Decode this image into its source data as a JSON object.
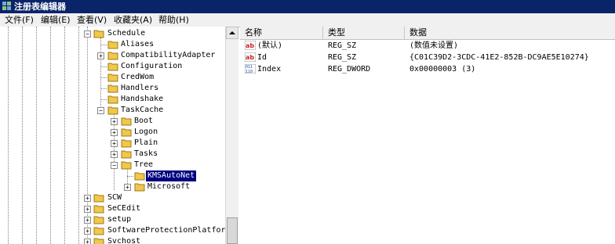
{
  "window": {
    "title": "注册表编辑器",
    "app_icon": "registry-editor-icon"
  },
  "menu": [
    {
      "label": "文件(F)"
    },
    {
      "label": "编辑(E)"
    },
    {
      "label": "查看(V)"
    },
    {
      "label": "收藏夹(A)"
    },
    {
      "label": "帮助(H)"
    }
  ],
  "tree": {
    "nodes": [
      {
        "label": "Schedule",
        "expander": "−"
      },
      {
        "label": "Aliases",
        "expander": ""
      },
      {
        "label": "CompatibilityAdapter",
        "expander": "+"
      },
      {
        "label": "Configuration",
        "expander": ""
      },
      {
        "label": "CredWom",
        "expander": ""
      },
      {
        "label": "Handlers",
        "expander": ""
      },
      {
        "label": "Handshake",
        "expander": ""
      },
      {
        "label": "TaskCache",
        "expander": "−"
      },
      {
        "label": "Boot",
        "expander": "+"
      },
      {
        "label": "Logon",
        "expander": "+"
      },
      {
        "label": "Plain",
        "expander": "+"
      },
      {
        "label": "Tasks",
        "expander": "+"
      },
      {
        "label": "Tree",
        "expander": "−"
      },
      {
        "label": "KMSAutoNet",
        "expander": "",
        "selected": true
      },
      {
        "label": "Microsoft",
        "expander": "+"
      },
      {
        "label": "SCW",
        "expander": "+"
      },
      {
        "label": "SeCEdit",
        "expander": "+"
      },
      {
        "label": "setup",
        "expander": "+"
      },
      {
        "label": "SoftwareProtectionPlatform",
        "expander": "+"
      },
      {
        "label": "Svchost",
        "expander": "+"
      }
    ]
  },
  "list": {
    "columns": [
      "名称",
      "类型",
      "数据"
    ],
    "rows": [
      {
        "name": "(默认)",
        "type": "REG_SZ",
        "data": "(数值未设置)",
        "icon": "string-value-icon"
      },
      {
        "name": "Id",
        "type": "REG_SZ",
        "data": "{C01C39D2-3CDC-41E2-852B-DC9AE5E10274}",
        "icon": "string-value-icon"
      },
      {
        "name": "Index",
        "type": "REG_DWORD",
        "data": "0x00000003 (3)",
        "icon": "binary-value-icon"
      }
    ]
  },
  "colors": {
    "titlebar": "#0a246a",
    "selection": "#000080",
    "folder": "#f0c84a",
    "string_icon": "#cc2222",
    "binary_icon": "#1f4fa8"
  }
}
